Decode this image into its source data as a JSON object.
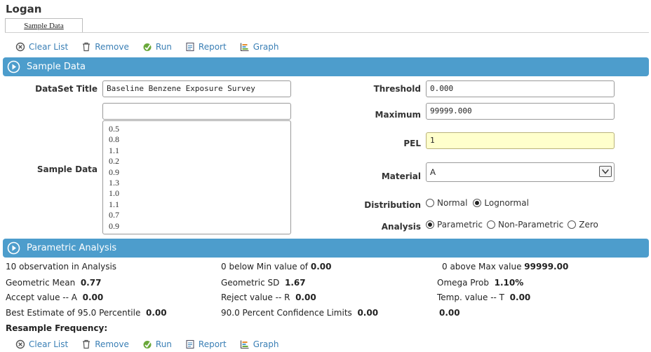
{
  "app": {
    "title": "Logan"
  },
  "tab": {
    "label": "Sample Data"
  },
  "toolbar": {
    "clear_list": "Clear List",
    "remove": "Remove",
    "run": "Run",
    "report": "Report",
    "graph": "Graph"
  },
  "sections": {
    "sample_data": "Sample Data",
    "parametric_analysis": "Parametric Analysis"
  },
  "form": {
    "dataset_title_label": "DataSet Title",
    "dataset_title_value": "Baseline Benzene Exposure Survey",
    "blank_field_value": "",
    "sample_data_label": "Sample Data",
    "sample_values": [
      "0.5",
      "0.8",
      "1.1",
      "0.2",
      "0.9",
      "1.3",
      "1.0",
      "1.1",
      "0.7",
      "0.9"
    ],
    "threshold_label": "Threshold",
    "threshold_value": "0.000",
    "maximum_label": "Maximum",
    "maximum_value": "99999.000",
    "pel_label": "PEL",
    "pel_value": "1",
    "material_label": "Material",
    "material_value": "A",
    "distribution_label": "Distribution",
    "distribution_options": [
      "Normal",
      "Lognormal"
    ],
    "distribution_selected": "Lognormal",
    "analysis_label": "Analysis",
    "analysis_options": [
      "Parametric",
      "Non-Parametric",
      "Zero"
    ],
    "analysis_selected": "Parametric"
  },
  "results": {
    "observations": "10 observation in Analysis",
    "below_min_text": "0 below Min value of",
    "below_min_value": "0.00",
    "above_max_text": "0 above Max value",
    "above_max_value": "99999.00",
    "geo_mean_label": "Geometric Mean",
    "geo_mean_value": "0.77",
    "geo_sd_label": "Geometric SD",
    "geo_sd_value": "1.67",
    "omega_label": "Omega Prob",
    "omega_value": "1.10%",
    "accept_label": "Accept value -- A",
    "accept_value": "0.00",
    "reject_label": "Reject value -- R",
    "reject_value": "0.00",
    "temp_label": "Temp. value -- T",
    "temp_value": "0.00",
    "best_est_label": "Best Estimate of 95.0 Percentile",
    "best_est_value": "0.00",
    "conf_label": "90.0 Percent Confidence Limits",
    "conf_value": "0.00",
    "conf_value2": "0.00",
    "resample_label": "Resample Frequency:"
  },
  "colors": {
    "section_bar": "#4d9dcc",
    "link": "#3a7fb5",
    "pel_background": "#ffffcc"
  },
  "icons": {
    "clear": "circle-x-icon",
    "remove": "trash-icon",
    "run": "run-icon",
    "report": "report-icon",
    "graph": "graph-icon",
    "section": "play-circle-icon"
  }
}
